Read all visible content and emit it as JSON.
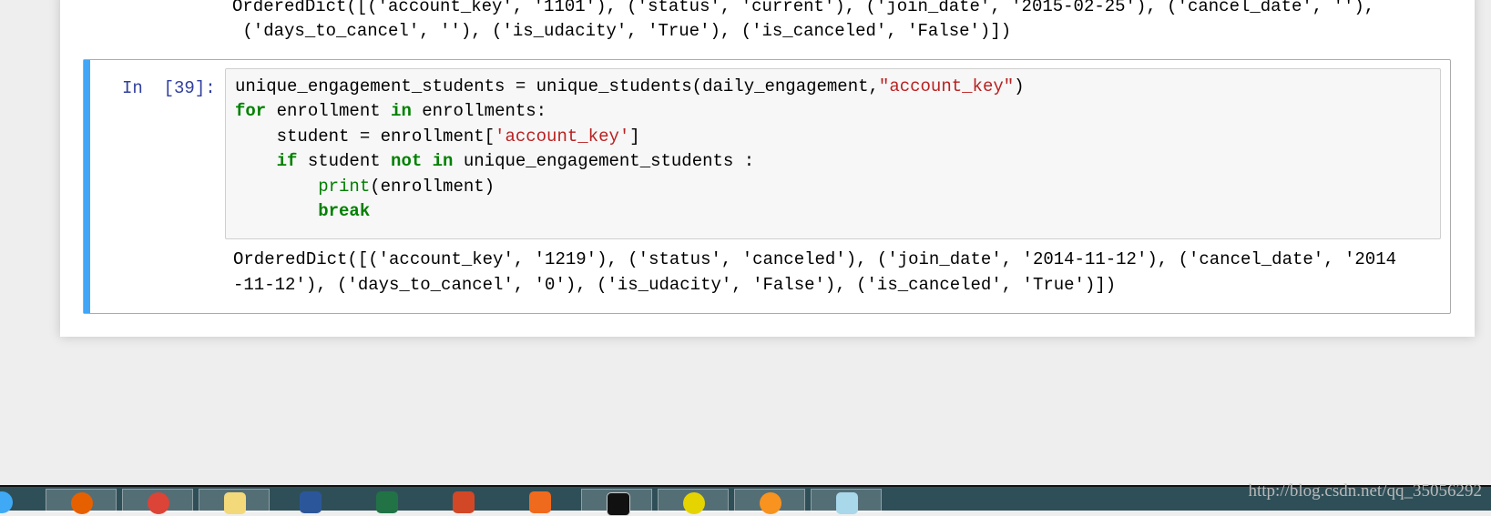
{
  "prev_output": {
    "line1": "OrderedDict([('account_key', '1101'), ('status', 'current'), ('join_date', '2015-02-25'), ('cancel_date', ''),",
    "line2": " ('days_to_cancel', ''), ('is_udacity', 'True'), ('is_canceled', 'False')])"
  },
  "cell": {
    "prompt": "In  [39]:",
    "code": {
      "l1a": "unique_engagement_students = unique_students(daily_engagement,",
      "l1s": "\"account_key\"",
      "l1b": ")",
      "l2k1": "for",
      "l2a": " enrollment ",
      "l2k2": "in",
      "l2b": " enrollments:",
      "l3a": "    student = enrollment[",
      "l3s": "'account_key'",
      "l3b": "]",
      "l4i": "    ",
      "l4k1": "if",
      "l4a": " student ",
      "l4k2": "not in",
      "l4b": " unique_engagement_students :",
      "l5i": "        ",
      "l5f": "print",
      "l5a": "(enrollment)",
      "l6i": "        ",
      "l6k": "break"
    },
    "output": {
      "line1": "OrderedDict([('account_key', '1219'), ('status', 'canceled'), ('join_date', '2014-11-12'), ('cancel_date', '2014",
      "line2": "-11-12'), ('days_to_cancel', '0'), ('is_udacity', 'False'), ('is_canceled', 'True')])"
    }
  },
  "taskbar": {
    "icons": [
      "ie-icon",
      "firefox-icon",
      "chrome-icon",
      "folder-icon",
      "word-icon",
      "excel-icon",
      "powerpoint-icon",
      "foxit-icon",
      "cmd-icon",
      "app-green-icon",
      "app-orange-icon",
      "notepad-icon"
    ],
    "watermark": "http://blog.csdn.net/qq_35056292"
  },
  "colors": {
    "cell_selected_bar": "#42a5f5",
    "prompt": "#303f9f",
    "keyword": "#008000",
    "string": "#ba2121"
  }
}
